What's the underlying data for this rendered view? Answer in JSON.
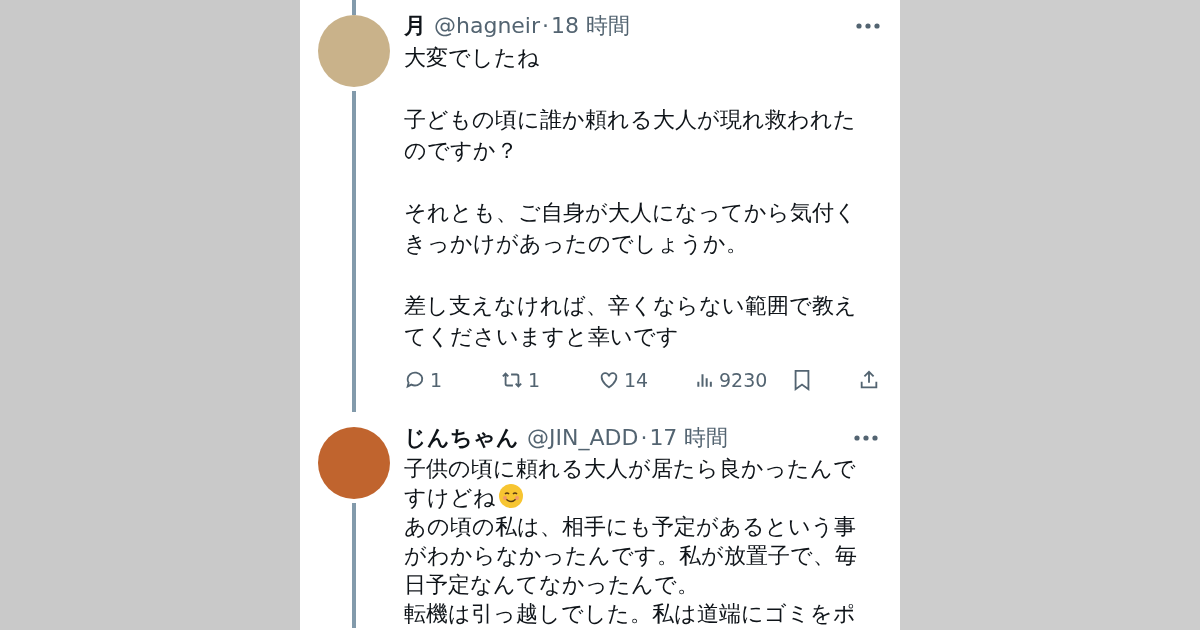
{
  "tweets": [
    {
      "name": "月",
      "handle": "@hagneir",
      "separator": "·",
      "time": "18 時間",
      "body": [
        {
          "lines": [
            "大変でしたね"
          ]
        },
        {
          "lines": [
            "子どもの頃に誰か頼れる大人が現れ救われた",
            "のですか？"
          ]
        },
        {
          "lines": [
            "それとも、ご自身が大人になってから気付く",
            "きっかけがあったのでしょうか。"
          ]
        },
        {
          "lines": [
            "差し支えなければ、辛くならない範囲で教え",
            "てくださいますと幸いです"
          ]
        }
      ],
      "actions": [
        {
          "kind": "reply",
          "count": "1"
        },
        {
          "kind": "retweet",
          "count": "1"
        },
        {
          "kind": "like",
          "count": "14"
        },
        {
          "kind": "views",
          "count": "9230"
        },
        {
          "kind": "bookmark"
        },
        {
          "kind": "share"
        }
      ]
    },
    {
      "name": "じんちゃん",
      "handle": "@JIN_ADD",
      "separator": "·",
      "time": "17 時間",
      "body": [
        {
          "lines": [
            "子供の頃に頼れる大人が居たら良かったんで",
            "すけどね"
          ],
          "kind": "text-with-smile"
        },
        {
          "lines": [
            "あの頃の私は、相手にも予定があるという事",
            "がわからなかったんです。私が放置子で、毎",
            "日予定なんてなかったんで。"
          ]
        },
        {
          "lines": [
            "転機は引っ越しでした。私は道端にゴミをポ"
          ]
        }
      ]
    }
  ]
}
